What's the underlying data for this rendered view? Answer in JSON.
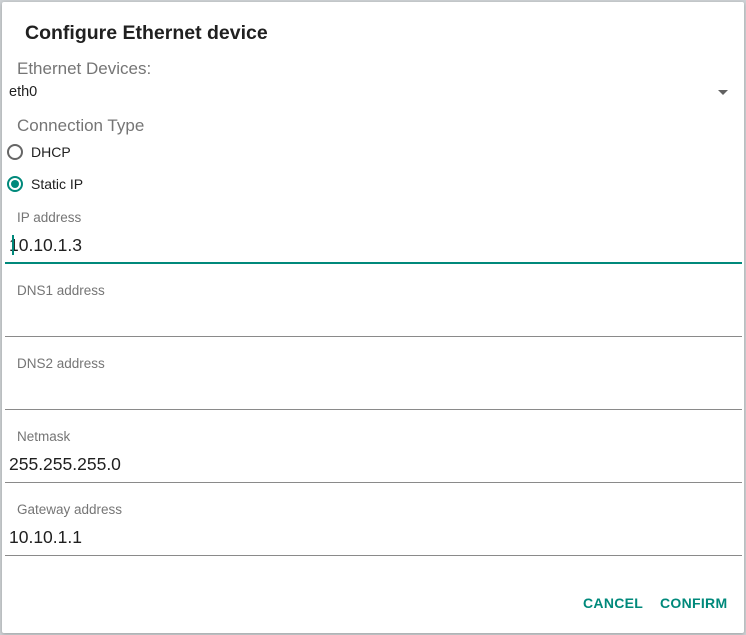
{
  "dialog": {
    "title": "Configure Ethernet device",
    "devices_label": "Ethernet Devices:",
    "selected_device": "eth0",
    "connection_type_label": "Connection Type",
    "connection_options": [
      {
        "label": "DHCP",
        "selected": false
      },
      {
        "label": "Static IP",
        "selected": true
      }
    ],
    "fields": {
      "ip": {
        "label": "IP address",
        "value": "10.10.1.3",
        "focused": true
      },
      "dns1": {
        "label": "DNS1 address",
        "value": ""
      },
      "dns2": {
        "label": "DNS2 address",
        "value": ""
      },
      "netmask": {
        "label": "Netmask",
        "value": "255.255.255.0"
      },
      "gateway": {
        "label": "Gateway address",
        "value": "10.10.1.1"
      }
    },
    "buttons": {
      "cancel": "CANCEL",
      "confirm": "CONFIRM"
    }
  },
  "colors": {
    "accent": "#00897b",
    "secondary_text": "#757575",
    "primary_text": "#202020"
  },
  "icons": {
    "dropdown": "chevron-down-icon"
  }
}
